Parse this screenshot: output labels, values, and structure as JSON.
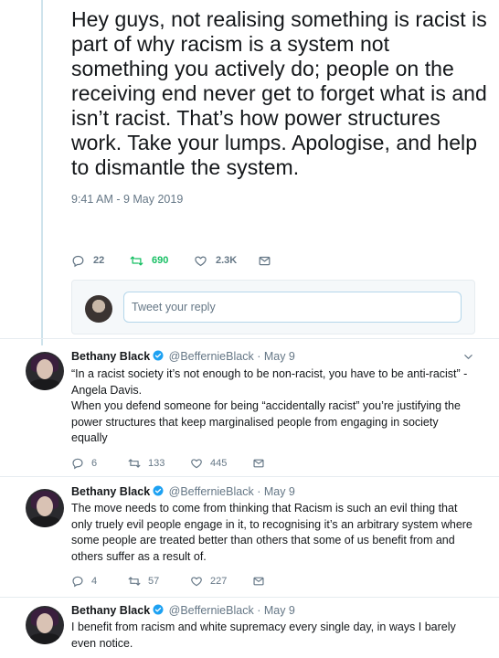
{
  "main_tweet": {
    "text": "Hey guys, not realising something is racist is part of why racism is a system not something you actively do; people on the receiving end never get to forget what is and isn’t racist.  That’s how power structures work. Take your lumps. Apologise, and help to dismantle the system.",
    "timestamp": "9:41 AM - 9 May 2019",
    "replies": "22",
    "retweets": "690",
    "likes": "2.3K"
  },
  "reply_box": {
    "placeholder": "Tweet your reply"
  },
  "replies": [
    {
      "name": "Bethany Black",
      "handle": "@BeffernieBlack",
      "separator": "·",
      "date": "May 9",
      "text_lines": [
        "“In a racist society it’s not enough to be non-racist, you have to be anti-racist” -",
        "Angela Davis.",
        "When you defend someone for being “accidentally racist” you’re justifying the",
        "power structures that keep marginalised people from engaging in society",
        "equally"
      ],
      "replies": "6",
      "retweets": "133",
      "likes": "445"
    },
    {
      "name": "Bethany Black",
      "handle": "@BeffernieBlack",
      "separator": "·",
      "date": "May 9",
      "text_lines": [
        "The move needs to come from thinking that Racism is such an evil thing that",
        "only truely evil people engage in it, to recognising it’s an arbitrary system where",
        "some people are treated better than others that some of us benefit from and",
        "others suffer as a result of."
      ],
      "replies": "4",
      "retweets": "57",
      "likes": "227"
    },
    {
      "name": "Bethany Black",
      "handle": "@BeffernieBlack",
      "separator": "·",
      "date": "May 9",
      "text_lines": [
        "I benefit from racism and white supremacy every single day, in ways I barely",
        "even notice."
      ]
    }
  ],
  "colors": {
    "text": "#14171a",
    "muted": "#657786",
    "retweet_active": "#17bf63",
    "verified": "#1da1f2",
    "divider": "#e6ecf0"
  },
  "icons": [
    "reply-icon",
    "retweet-icon",
    "like-icon",
    "direct-message-icon",
    "verified-badge-icon",
    "chevron-down-icon"
  ]
}
